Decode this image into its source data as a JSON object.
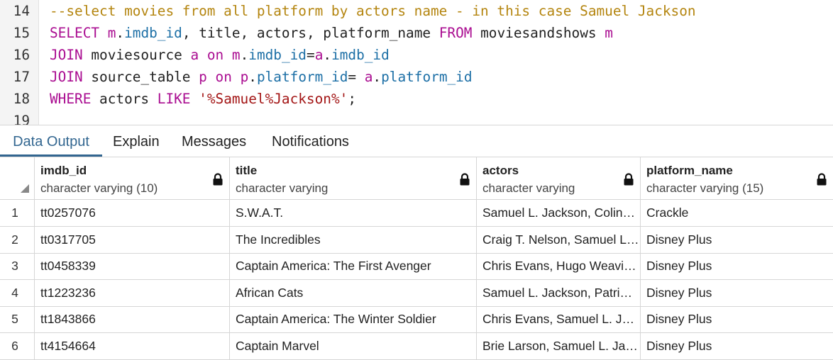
{
  "editor": {
    "lines": [
      {
        "num": "14",
        "tokens": [
          {
            "t": "--select movies from all platform by actors name - in this case Samuel Jackson",
            "c": "cm"
          }
        ]
      },
      {
        "num": "15",
        "tokens": [
          {
            "t": "SELECT",
            "c": "kw"
          },
          {
            "t": " ",
            "c": ""
          },
          {
            "t": "m",
            "c": "alias"
          },
          {
            "t": ".",
            "c": ""
          },
          {
            "t": "imdb_id",
            "c": "col"
          },
          {
            "t": ", title, actors, platform_name ",
            "c": ""
          },
          {
            "t": "FROM",
            "c": "kw"
          },
          {
            "t": " moviesandshows ",
            "c": ""
          },
          {
            "t": "m",
            "c": "alias"
          }
        ]
      },
      {
        "num": "16",
        "tokens": [
          {
            "t": "JOIN",
            "c": "kw"
          },
          {
            "t": " moviesource ",
            "c": ""
          },
          {
            "t": "a",
            "c": "alias"
          },
          {
            "t": " ",
            "c": ""
          },
          {
            "t": "on",
            "c": "kw"
          },
          {
            "t": " ",
            "c": ""
          },
          {
            "t": "m",
            "c": "alias"
          },
          {
            "t": ".",
            "c": ""
          },
          {
            "t": "imdb_id",
            "c": "col"
          },
          {
            "t": "=",
            "c": ""
          },
          {
            "t": "a",
            "c": "alias"
          },
          {
            "t": ".",
            "c": ""
          },
          {
            "t": "imdb_id",
            "c": "col"
          }
        ]
      },
      {
        "num": "17",
        "tokens": [
          {
            "t": "JOIN",
            "c": "kw"
          },
          {
            "t": " source_table ",
            "c": ""
          },
          {
            "t": "p",
            "c": "alias"
          },
          {
            "t": " ",
            "c": ""
          },
          {
            "t": "on",
            "c": "kw"
          },
          {
            "t": " ",
            "c": ""
          },
          {
            "t": "p",
            "c": "alias"
          },
          {
            "t": ".",
            "c": ""
          },
          {
            "t": "platform_id",
            "c": "col"
          },
          {
            "t": "= ",
            "c": ""
          },
          {
            "t": "a",
            "c": "alias"
          },
          {
            "t": ".",
            "c": ""
          },
          {
            "t": "platform_id",
            "c": "col"
          }
        ]
      },
      {
        "num": "18",
        "tokens": [
          {
            "t": "WHERE",
            "c": "kw"
          },
          {
            "t": " actors ",
            "c": ""
          },
          {
            "t": "LIKE",
            "c": "kw"
          },
          {
            "t": " ",
            "c": ""
          },
          {
            "t": "'%Samuel%Jackson%'",
            "c": "str"
          },
          {
            "t": ";",
            "c": ""
          }
        ]
      },
      {
        "num": "19",
        "tokens": []
      }
    ]
  },
  "tabs": [
    "Data Output",
    "Explain",
    "Messages",
    "Notifications"
  ],
  "active_tab": "Data Output",
  "grid": {
    "columns": [
      {
        "name": "imdb_id",
        "type": "character varying (10)"
      },
      {
        "name": "title",
        "type": "character varying"
      },
      {
        "name": "actors",
        "type": "character varying"
      },
      {
        "name": "platform_name",
        "type": "character varying (15)"
      }
    ],
    "rows": [
      {
        "n": "1",
        "imdb_id": "tt0257076",
        "title": "S.W.A.T.",
        "actors": "Samuel L. Jackson, Colin…",
        "platform_name": "Crackle"
      },
      {
        "n": "2",
        "imdb_id": "tt0317705",
        "title": "The Incredibles",
        "actors": "Craig T. Nelson, Samuel L…",
        "platform_name": "Disney Plus"
      },
      {
        "n": "3",
        "imdb_id": "tt0458339",
        "title": "Captain America: The First Avenger",
        "actors": "Chris Evans, Hugo Weavi…",
        "platform_name": "Disney Plus"
      },
      {
        "n": "4",
        "imdb_id": "tt1223236",
        "title": "African Cats",
        "actors": "Samuel L. Jackson, Patri…",
        "platform_name": "Disney Plus"
      },
      {
        "n": "5",
        "imdb_id": "tt1843866",
        "title": "Captain America: The Winter Soldier",
        "actors": "Chris Evans, Samuel L. J…",
        "platform_name": "Disney Plus"
      },
      {
        "n": "6",
        "imdb_id": "tt4154664",
        "title": "Captain Marvel",
        "actors": "Brie Larson, Samuel L. Ja…",
        "platform_name": "Disney Plus"
      }
    ]
  },
  "colors": {
    "accent": "#326690",
    "keyword": "#aa0d91",
    "column": "#1c6fa6",
    "comment": "#b4850f",
    "string": "#a31515"
  },
  "icons": {
    "column_lock": "lock-icon",
    "select_all": "sort-corner-icon"
  }
}
